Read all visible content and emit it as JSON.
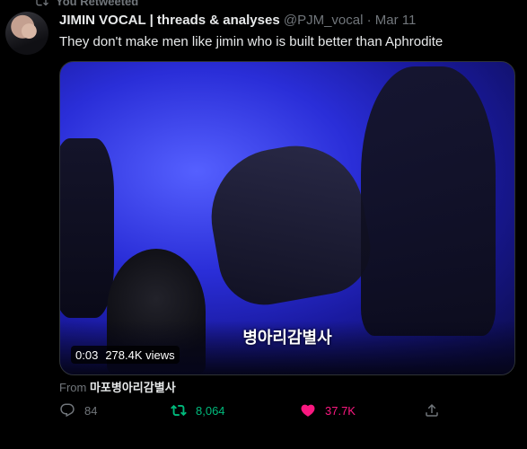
{
  "retweet_context": {
    "label": "You Retweeted"
  },
  "tweet": {
    "author_name": "JIMIN VOCAL | threads & analyses",
    "handle": "@PJM_vocal",
    "separator": "·",
    "date": "Mar 11",
    "text": "They don't make men like jimin who is built better than Aphrodite",
    "media": {
      "caption": "병아리감별사",
      "duration": "0:03",
      "views": "278.4K views"
    },
    "from": {
      "prefix": "From",
      "source": "마포병아리감별사"
    },
    "actions": {
      "replies": "84",
      "retweets": "8,064",
      "likes": "37.7K"
    }
  },
  "colors": {
    "background": "#000000",
    "secondary_text": "#71767b",
    "retweet_green": "#00ba7c",
    "like_pink": "#f91880"
  }
}
